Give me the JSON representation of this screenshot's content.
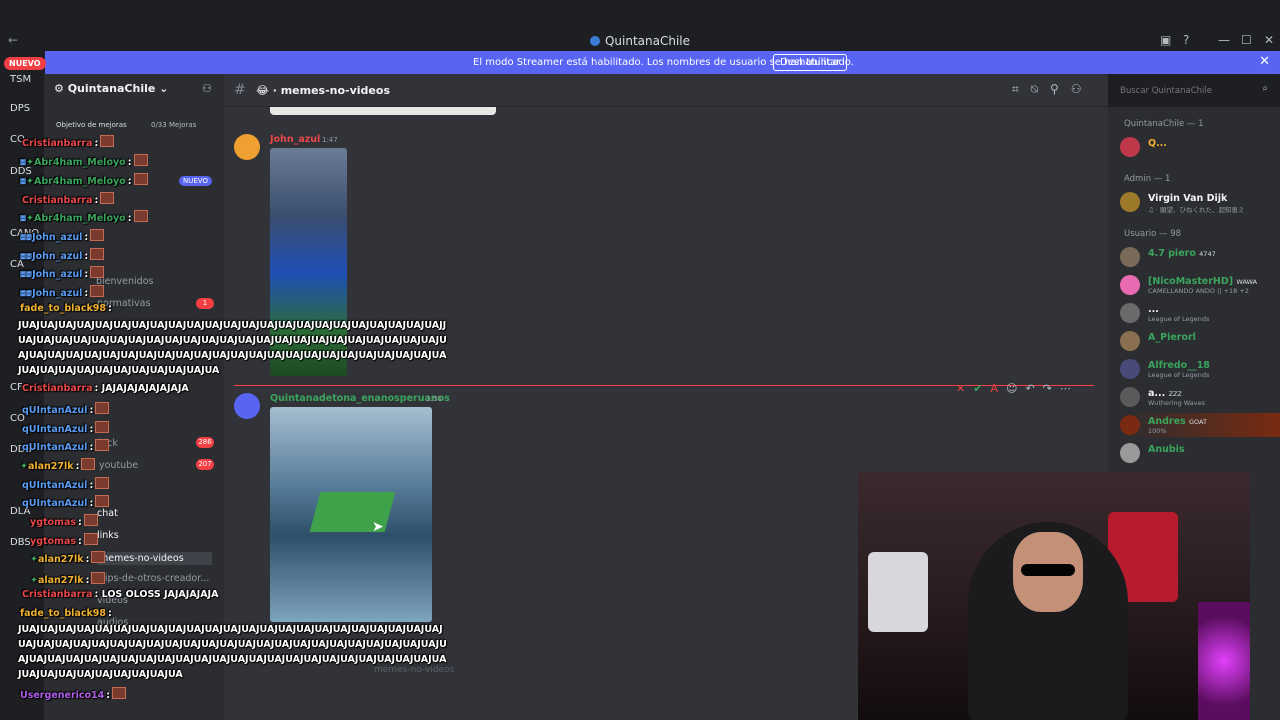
{
  "window": {
    "title": "QuintanaChile",
    "back_icon": "arrow-left",
    "controls": [
      "inbox-icon",
      "help-icon",
      "minimize",
      "maximize",
      "close"
    ]
  },
  "banner": {
    "text": "El modo Streamer está habilitado. Los nombres de usuario se han truncado.",
    "button": "Deshabilitar",
    "close": "✕"
  },
  "nuevo_pill": "NUEVO",
  "servers": [
    "TSM",
    "DPS",
    "CO",
    "DDS",
    "CANO",
    "CA",
    "CF",
    "CO",
    "DDS",
    "DLA",
    "DBS"
  ],
  "sidebar": {
    "guild_name": "QuintanaChile",
    "goal_label": "Objetivo de mejoras",
    "goal_count": "0/33 Mejoras",
    "nuevo_badge": "NUEVO",
    "channels": [
      {
        "label": "bienvenidos"
      },
      {
        "label": "normativas",
        "badge": "1"
      },
      {
        "label": "kick",
        "badge": "286"
      },
      {
        "label": "youtube",
        "badge": "207"
      },
      {
        "label": "chat"
      },
      {
        "label": "links"
      },
      {
        "label": "memes-no-videos"
      },
      {
        "label": "clips-de-otros-creador..."
      },
      {
        "label": "videos"
      },
      {
        "label": "audios"
      }
    ]
  },
  "chat_header": {
    "channel": "memes-no-videos",
    "emoji": "😂"
  },
  "search": {
    "placeholder": "Buscar QuintanaChile"
  },
  "messages": [
    {
      "author": "John_azul",
      "time": "1:47",
      "color": "#e8484a"
    },
    {
      "author": "Quintanadetona_enanosperuanos",
      "time": "1:50",
      "color": "#3ba55d"
    }
  ],
  "composer_hint": "memes-no-videos",
  "members": {
    "groups": [
      {
        "label": "QuintanaChile — 1",
        "members": [
          {
            "name": "Q...",
            "color": "#f0b232",
            "status": ""
          }
        ]
      },
      {
        "label": "Admin — 1",
        "members": [
          {
            "name": "Virgin Van Dijk",
            "color": "#f2f3f5",
            "status": "♫ · 願望、ひねくれた、超知恵ミ"
          }
        ]
      },
      {
        "label": "Usuario — 98",
        "members": [
          {
            "name": "4.7 piero",
            "color": "#3ba55d",
            "tag": "4747",
            "status": ""
          },
          {
            "name": "[NicoMasterHD]",
            "color": "#3ba55d",
            "tag": "WAWA",
            "status": "CAMELLANDO ANDO || +18 +2"
          },
          {
            "name": "...",
            "color": "#f2f3f5",
            "status": "League of Legends"
          },
          {
            "name": "A_Pierorl",
            "color": "#3ba55d",
            "status": ""
          },
          {
            "name": "Alfredo__18",
            "color": "#3ba55d",
            "status": "League of Legends"
          },
          {
            "name": "a...",
            "color": "#f2f3f5",
            "tag": "ZZZ",
            "status": "Wuthering Waves"
          },
          {
            "name": "Andres",
            "color": "#3ba55d",
            "tag": "GOAT",
            "status": "100%"
          },
          {
            "name": "Anubis",
            "color": "#3ba55d",
            "status": ""
          }
        ]
      }
    ]
  },
  "chat_overlay": [
    {
      "user": "Cristianbarra",
      "color": "#e8484a",
      "text": ""
    },
    {
      "user": "Abr4ham_Meloyo",
      "color": "#3ba55d",
      "text": ""
    },
    {
      "user": "Abr4ham_Meloyo",
      "color": "#3ba55d",
      "text": ""
    },
    {
      "user": "Cristianbarra",
      "color": "#e8484a",
      "text": ""
    },
    {
      "user": "Abr4ham_Meloyo",
      "color": "#3ba55d",
      "text": ""
    },
    {
      "user": "John_azul",
      "color": "#5b9cf2",
      "text": ""
    },
    {
      "user": "John_azul",
      "color": "#5b9cf2",
      "text": ""
    },
    {
      "user": "John_azul",
      "color": "#5b9cf2",
      "text": ""
    },
    {
      "user": "John_azul",
      "color": "#5b9cf2",
      "text": ""
    },
    {
      "user": "fade_to_black98",
      "color": "#f0b232",
      "text": ""
    },
    {
      "user": "",
      "color": "#ffffff",
      "text": "JUAJUAJUAJUAJUAJUAJUAJUAJUAJUAJUAJUAJUAJUAJUAJUAJUAJUAJUAJUAJUAJUAJUAJJUAJUAJUAJUAJUAJUAJUAJUAJUAJUAJUAJUAJUAJUAJUAJUAJUAJUAJUAJUAJUAJUAJUAJUAJUAJUAJUAJUAJUAJUAJUAJUAJUAJUAJUAJUAJUAJUAJUAJUAJUAJUAJUAJUAJUAJUAJUAJUAJUAJUAJUAJUAJUAJUAJUAJUAJUAJUA"
    },
    {
      "user": "Cristianbarra",
      "color": "#e8484a",
      "text": "JAJAJAJAJAJAJAJA"
    },
    {
      "user": "qUIntanAzul",
      "color": "#5b9cf2",
      "text": ""
    },
    {
      "user": "qUIntanAzul",
      "color": "#5b9cf2",
      "text": ""
    },
    {
      "user": "qUIntanAzul",
      "color": "#5b9cf2",
      "text": ""
    },
    {
      "user": "alan27lk",
      "color": "#f0b232",
      "text": ""
    },
    {
      "user": "qUIntanAzul",
      "color": "#5b9cf2",
      "text": ""
    },
    {
      "user": "qUIntanAzul",
      "color": "#5b9cf2",
      "text": ""
    },
    {
      "user": "ygtomas",
      "color": "#e8484a",
      "text": ""
    },
    {
      "user": "ygtomas",
      "color": "#e8484a",
      "text": ""
    },
    {
      "user": "alan27lk",
      "color": "#f0b232",
      "text": ""
    },
    {
      "user": "alan27lk",
      "color": "#f0b232",
      "text": ""
    },
    {
      "user": "Cristianbarra",
      "color": "#e8484a",
      "text": "LOS OLOSS JAJAJAJAJA"
    },
    {
      "user": "fade_to_black98",
      "color": "#f0b232",
      "text": ""
    },
    {
      "user": "",
      "color": "#ffffff",
      "text": "JUAJUAJUAJUAJUAJUAJUAJUAJUAJUAJUAJUAJUAJUAJUAJUAJUAJUAJUAJUAJUAJUAJUAJUAJUAJUAJUAJUAJUAJUAJUAJUAJUAJUAJUAJUAJUAJUAJUAJUAJUAJUAJUAJUAJUAJUAJUAJUAJUAJUAJUAJUAJUAJUAJUAJUAJUAJUAJUAJUAJUAJUAJUAJUAJUAJUAJUAJUAJUAJUAJUAJUAJUAJUAJUAJUAJUAJUAJUA"
    },
    {
      "user": "Usergenerico14",
      "color": "#b05ee8",
      "text": ""
    }
  ]
}
